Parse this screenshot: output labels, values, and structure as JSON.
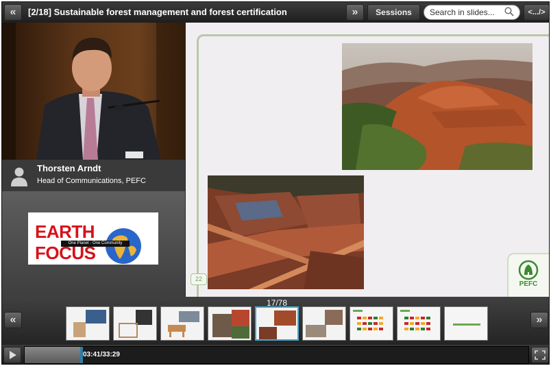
{
  "topbar": {
    "prev_label": "«",
    "title": "[2/18] Sustainable forest management and forest certification",
    "next_label": "»",
    "sessions_label": "Sessions",
    "search_placeholder": "Search in slides...",
    "embed_label": "<.../>"
  },
  "speaker": {
    "name": "Thorsten Arndt",
    "role": "Head of Communications, PEFC",
    "icon": "person-icon"
  },
  "sponsor_logo": {
    "text": "EARTH FOCUS",
    "tagline": "One Planet - One Community"
  },
  "slide": {
    "page_number": "22",
    "logo_text": "PEFC"
  },
  "thumbnails": {
    "counter": "17/78",
    "prev_label": "«",
    "next_label": "»",
    "active_index": 4,
    "count": 9
  },
  "player": {
    "time": "03:41/33:29",
    "progress_fraction": 0.11
  },
  "colors": {
    "accent": "#2f7ea5",
    "earth_focus_red": "#d6121a",
    "pefc_green": "#3c8b2e"
  }
}
